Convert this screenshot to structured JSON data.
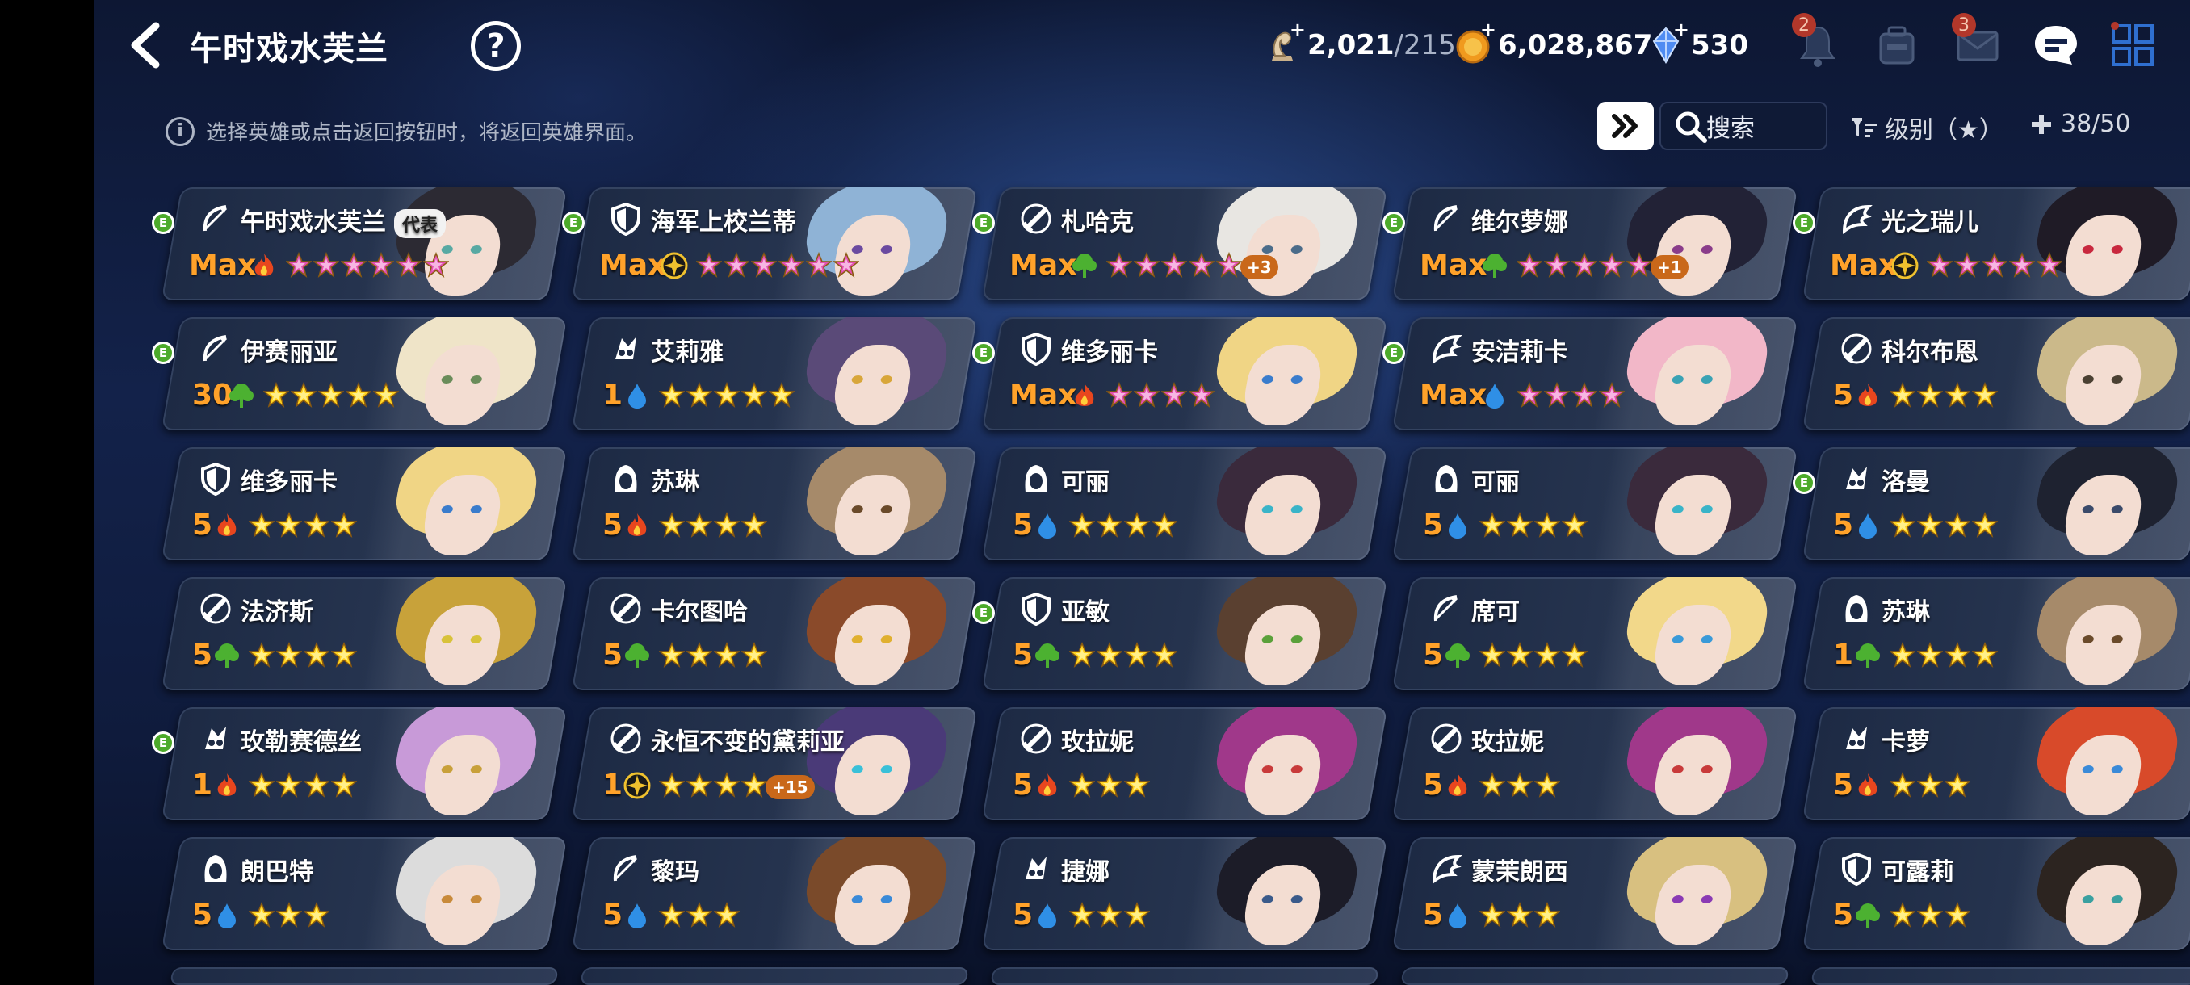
{
  "header": {
    "title": "午时戏水芙兰",
    "help": "?"
  },
  "currencies": [
    {
      "icon": "crown-icon",
      "value": "2,021",
      "cap": "/215"
    },
    {
      "icon": "gold-coin-icon",
      "value": "6,028,867"
    },
    {
      "icon": "gem-icon",
      "value": "530"
    }
  ],
  "top_icons": [
    {
      "icon": "bell-icon",
      "badge": "2"
    },
    {
      "icon": "inventory-icon",
      "badge": ""
    },
    {
      "icon": "mail-icon",
      "badge": "3"
    },
    {
      "icon": "chat-icon",
      "badge": ""
    },
    {
      "icon": "grid-menu-icon",
      "badge": ""
    }
  ],
  "hint": "选择英雄或点击返回按钮时，将返回英雄界面。",
  "search": {
    "label": "搜索"
  },
  "sort": {
    "label": "级别（★）"
  },
  "count": {
    "label": "38/50"
  },
  "colors": {
    "fire": "#e8461e",
    "earth": "#4cb131",
    "water": "#2f8fe6",
    "light": "#f0c12e",
    "level": "#ffa22a",
    "star": "#ffd21f",
    "star_pink": "#e24fb0"
  },
  "heroes": [
    {
      "name": "午时戏水芙兰",
      "rep": "代表",
      "cls": "bow",
      "level": "Max",
      "element": "fire",
      "stars": 6,
      "star_color": "pink",
      "plus": "",
      "equip": true,
      "hair": "#2c2a33",
      "eye": "#58a9a3"
    },
    {
      "name": "海军上校兰蒂",
      "rep": "",
      "cls": "shield",
      "level": "Max",
      "element": "light",
      "stars": 6,
      "star_color": "pink",
      "plus": "",
      "equip": true,
      "hair": "#8fb3d6",
      "eye": "#6b4aa0"
    },
    {
      "name": "札哈克",
      "rep": "",
      "cls": "sword",
      "level": "Max",
      "element": "earth",
      "stars": 5,
      "star_color": "pink",
      "plus": "+3",
      "equip": true,
      "hair": "#e8e6e2",
      "eye": "#4b6c8a"
    },
    {
      "name": "维尔萝娜",
      "rep": "",
      "cls": "bow",
      "level": "Max",
      "element": "earth",
      "stars": 5,
      "star_color": "pink",
      "plus": "+1",
      "equip": true,
      "hair": "#222236",
      "eye": "#8a3c8a"
    },
    {
      "name": "光之瑞儿",
      "rep": "",
      "cls": "wing",
      "level": "Max",
      "element": "light",
      "stars": 5,
      "star_color": "pink",
      "plus": "",
      "equip": true,
      "hair": "#1f1b26",
      "eye": "#c8283e"
    },
    {
      "name": "伊赛丽亚",
      "rep": "",
      "cls": "bow",
      "level": "30",
      "element": "earth",
      "stars": 5,
      "star_color": "gold",
      "plus": "",
      "equip": true,
      "hair": "#efe4c8",
      "eye": "#6a8c5a"
    },
    {
      "name": "艾莉雅",
      "rep": "",
      "cls": "mage",
      "level": "1",
      "element": "water",
      "stars": 5,
      "star_color": "gold",
      "plus": "",
      "equip": false,
      "hair": "#5a4a78",
      "eye": "#d8a63a"
    },
    {
      "name": "维多丽卡",
      "rep": "",
      "cls": "shield",
      "level": "Max",
      "element": "fire",
      "stars": 4,
      "star_color": "pink",
      "plus": "",
      "equip": true,
      "hair": "#f0d585",
      "eye": "#3a7ccc"
    },
    {
      "name": "安洁莉卡",
      "rep": "",
      "cls": "wing",
      "level": "Max",
      "element": "water",
      "stars": 4,
      "star_color": "pink",
      "plus": "",
      "equip": true,
      "hair": "#f2b7c8",
      "eye": "#3aa2b4"
    },
    {
      "name": "科尔布恩",
      "rep": "",
      "cls": "sword",
      "level": "5",
      "element": "fire",
      "stars": 4,
      "star_color": "gold",
      "plus": "",
      "equip": false,
      "hair": "#cbb98a",
      "eye": "#4a4032"
    },
    {
      "name": "维多丽卡",
      "rep": "",
      "cls": "shield",
      "level": "5",
      "element": "fire",
      "stars": 4,
      "star_color": "gold",
      "plus": "",
      "equip": false,
      "hair": "#f0d585",
      "eye": "#3a7ccc"
    },
    {
      "name": "苏琳",
      "rep": "",
      "cls": "hood",
      "level": "5",
      "element": "fire",
      "stars": 4,
      "star_color": "gold",
      "plus": "",
      "equip": false,
      "hair": "#a68a6a",
      "eye": "#6a4a2a"
    },
    {
      "name": "可丽",
      "rep": "",
      "cls": "hood",
      "level": "5",
      "element": "water",
      "stars": 4,
      "star_color": "gold",
      "plus": "",
      "equip": false,
      "hair": "#3a2a3c",
      "eye": "#3ab4c8"
    },
    {
      "name": "可丽",
      "rep": "",
      "cls": "hood",
      "level": "5",
      "element": "water",
      "stars": 4,
      "star_color": "gold",
      "plus": "",
      "equip": false,
      "hair": "#3a2a3c",
      "eye": "#3ab4c8"
    },
    {
      "name": "洛曼",
      "rep": "",
      "cls": "mage",
      "level": "5",
      "element": "water",
      "stars": 4,
      "star_color": "gold",
      "plus": "",
      "equip": true,
      "hair": "#1e2230",
      "eye": "#3a4a6a"
    },
    {
      "name": "法济斯",
      "rep": "",
      "cls": "sword",
      "level": "5",
      "element": "earth",
      "stars": 4,
      "star_color": "gold",
      "plus": "",
      "equip": false,
      "hair": "#c8a23a",
      "eye": "#d8c23a"
    },
    {
      "name": "卡尔图哈",
      "rep": "",
      "cls": "sword",
      "level": "5",
      "element": "earth",
      "stars": 4,
      "star_color": "gold",
      "plus": "",
      "equip": false,
      "hair": "#8a4a2a",
      "eye": "#e0b030"
    },
    {
      "name": "亚敏",
      "rep": "",
      "cls": "shield",
      "level": "5",
      "element": "earth",
      "stars": 4,
      "star_color": "gold",
      "plus": "",
      "equip": true,
      "hair": "#5a4030",
      "eye": "#5aa03a"
    },
    {
      "name": "席可",
      "rep": "",
      "cls": "bow",
      "level": "5",
      "element": "earth",
      "stars": 4,
      "star_color": "gold",
      "plus": "",
      "equip": false,
      "hair": "#f2d88a",
      "eye": "#3a9ad8"
    },
    {
      "name": "苏琳",
      "rep": "",
      "cls": "hood",
      "level": "1",
      "element": "earth",
      "stars": 4,
      "star_color": "gold",
      "plus": "",
      "equip": false,
      "hair": "#a68a6a",
      "eye": "#6a4a2a"
    },
    {
      "name": "玫勒赛德丝",
      "rep": "",
      "cls": "mage",
      "level": "1",
      "element": "fire",
      "stars": 4,
      "star_color": "gold",
      "plus": "",
      "equip": true,
      "hair": "#c89ad8",
      "eye": "#c8a03a"
    },
    {
      "name": "永恒不变的黛莉亚",
      "rep": "",
      "cls": "sword",
      "level": "1",
      "element": "light",
      "stars": 4,
      "star_color": "gold",
      "plus": "+15",
      "equip": false,
      "hair": "#4a3a78",
      "eye": "#3ac0d8"
    },
    {
      "name": "玫拉妮",
      "rep": "",
      "cls": "sword",
      "level": "5",
      "element": "fire",
      "stars": 3,
      "star_color": "gold",
      "plus": "",
      "equip": false,
      "hair": "#a0388a",
      "eye": "#c83a3a"
    },
    {
      "name": "玫拉妮",
      "rep": "",
      "cls": "sword",
      "level": "5",
      "element": "fire",
      "stars": 3,
      "star_color": "gold",
      "plus": "",
      "equip": false,
      "hair": "#a0388a",
      "eye": "#c83a3a"
    },
    {
      "name": "卡萝",
      "rep": "",
      "cls": "mage",
      "level": "5",
      "element": "fire",
      "stars": 3,
      "star_color": "gold",
      "plus": "",
      "equip": false,
      "hair": "#d84a2a",
      "eye": "#3a8ad8"
    },
    {
      "name": "朗巴特",
      "rep": "",
      "cls": "hood",
      "level": "5",
      "element": "water",
      "stars": 3,
      "star_color": "gold",
      "plus": "",
      "equip": false,
      "hair": "#dcdcdc",
      "eye": "#c88a3a"
    },
    {
      "name": "黎玛",
      "rep": "",
      "cls": "bow",
      "level": "5",
      "element": "water",
      "stars": 3,
      "star_color": "gold",
      "plus": "",
      "equip": false,
      "hair": "#7a4a2a",
      "eye": "#3a8ad8"
    },
    {
      "name": "捷娜",
      "rep": "",
      "cls": "mage",
      "level": "5",
      "element": "water",
      "stars": 3,
      "star_color": "gold",
      "plus": "",
      "equip": false,
      "hair": "#1c1c28",
      "eye": "#3a5a8a"
    },
    {
      "name": "蒙茉朗西",
      "rep": "",
      "cls": "wing",
      "level": "5",
      "element": "water",
      "stars": 3,
      "star_color": "gold",
      "plus": "",
      "equip": false,
      "hair": "#d8c080",
      "eye": "#8a3ab4"
    },
    {
      "name": "可露莉",
      "rep": "",
      "cls": "shield",
      "level": "5",
      "element": "earth",
      "stars": 3,
      "star_color": "gold",
      "plus": "",
      "equip": false,
      "hair": "#2c2420",
      "eye": "#3aa0a0"
    }
  ]
}
